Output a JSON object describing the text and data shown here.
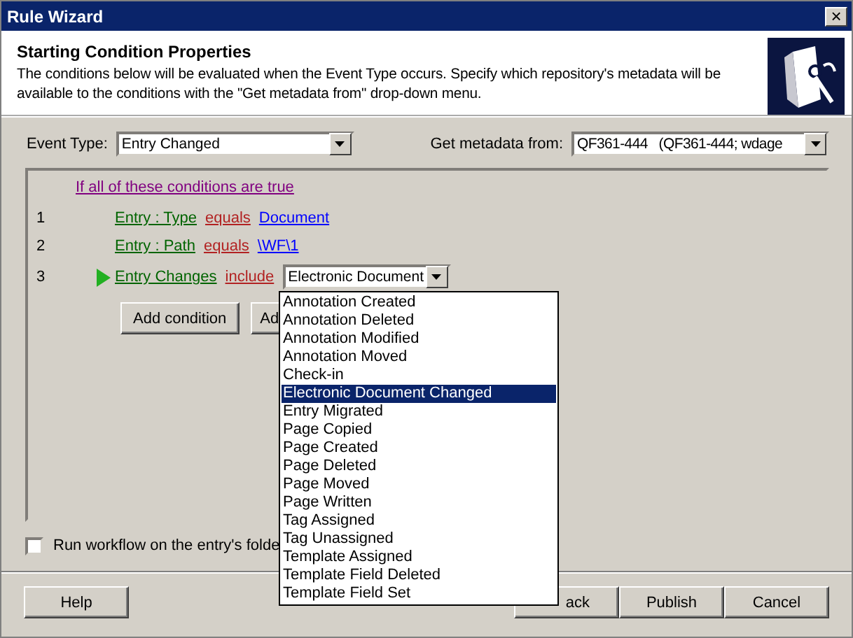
{
  "window": {
    "title": "Rule Wizard",
    "close": "×"
  },
  "header": {
    "title": "Starting Condition Properties",
    "description": "The conditions below will be evaluated when the Event Type occurs. Specify which repository's metadata will be available to the conditions with the \"Get metadata from\" drop-down menu."
  },
  "event_type": {
    "label": "Event Type:",
    "value": "Entry Changed"
  },
  "metadata_from": {
    "label": "Get metadata from:",
    "value": "QF361-444   (QF361-444; wdage"
  },
  "conditions": {
    "heading": "If all of these conditions are true",
    "rows": [
      {
        "number": "1",
        "field": "Entry : Type",
        "operator": "equals",
        "value": "Document",
        "kind": "link",
        "current": false
      },
      {
        "number": "2",
        "field": "Entry : Path",
        "operator": "equals",
        "value": "\\WF\\1",
        "kind": "link",
        "current": false
      },
      {
        "number": "3",
        "field": "Entry Changes",
        "operator": "include",
        "value": "Electronic Document",
        "kind": "dropdown",
        "current": true
      }
    ],
    "buttons": [
      "Add condition",
      "Ad"
    ]
  },
  "dropdown_list": {
    "items": [
      {
        "label": "Annotation Created",
        "selected": false
      },
      {
        "label": "Annotation Deleted",
        "selected": false
      },
      {
        "label": "Annotation Modified",
        "selected": false
      },
      {
        "label": "Annotation Moved",
        "selected": false
      },
      {
        "label": "Check-in",
        "selected": false
      },
      {
        "label": "Electronic Document Changed",
        "selected": true
      },
      {
        "label": "Entry Migrated",
        "selected": false
      },
      {
        "label": "Page Copied",
        "selected": false
      },
      {
        "label": "Page Created",
        "selected": false
      },
      {
        "label": "Page Deleted",
        "selected": false
      },
      {
        "label": "Page Moved",
        "selected": false
      },
      {
        "label": "Page Written",
        "selected": false
      },
      {
        "label": "Tag Assigned",
        "selected": false
      },
      {
        "label": "Tag Unassigned",
        "selected": false
      },
      {
        "label": "Template Assigned",
        "selected": false
      },
      {
        "label": "Template Field Deleted",
        "selected": false
      },
      {
        "label": "Template Field Set",
        "selected": false
      }
    ]
  },
  "run_on_folder": {
    "label": "Run workflow on the entry's folde",
    "checked": false
  },
  "buttons": {
    "left": [
      "Help"
    ],
    "right": [
      "ack",
      "Publish",
      "Cancel"
    ]
  }
}
